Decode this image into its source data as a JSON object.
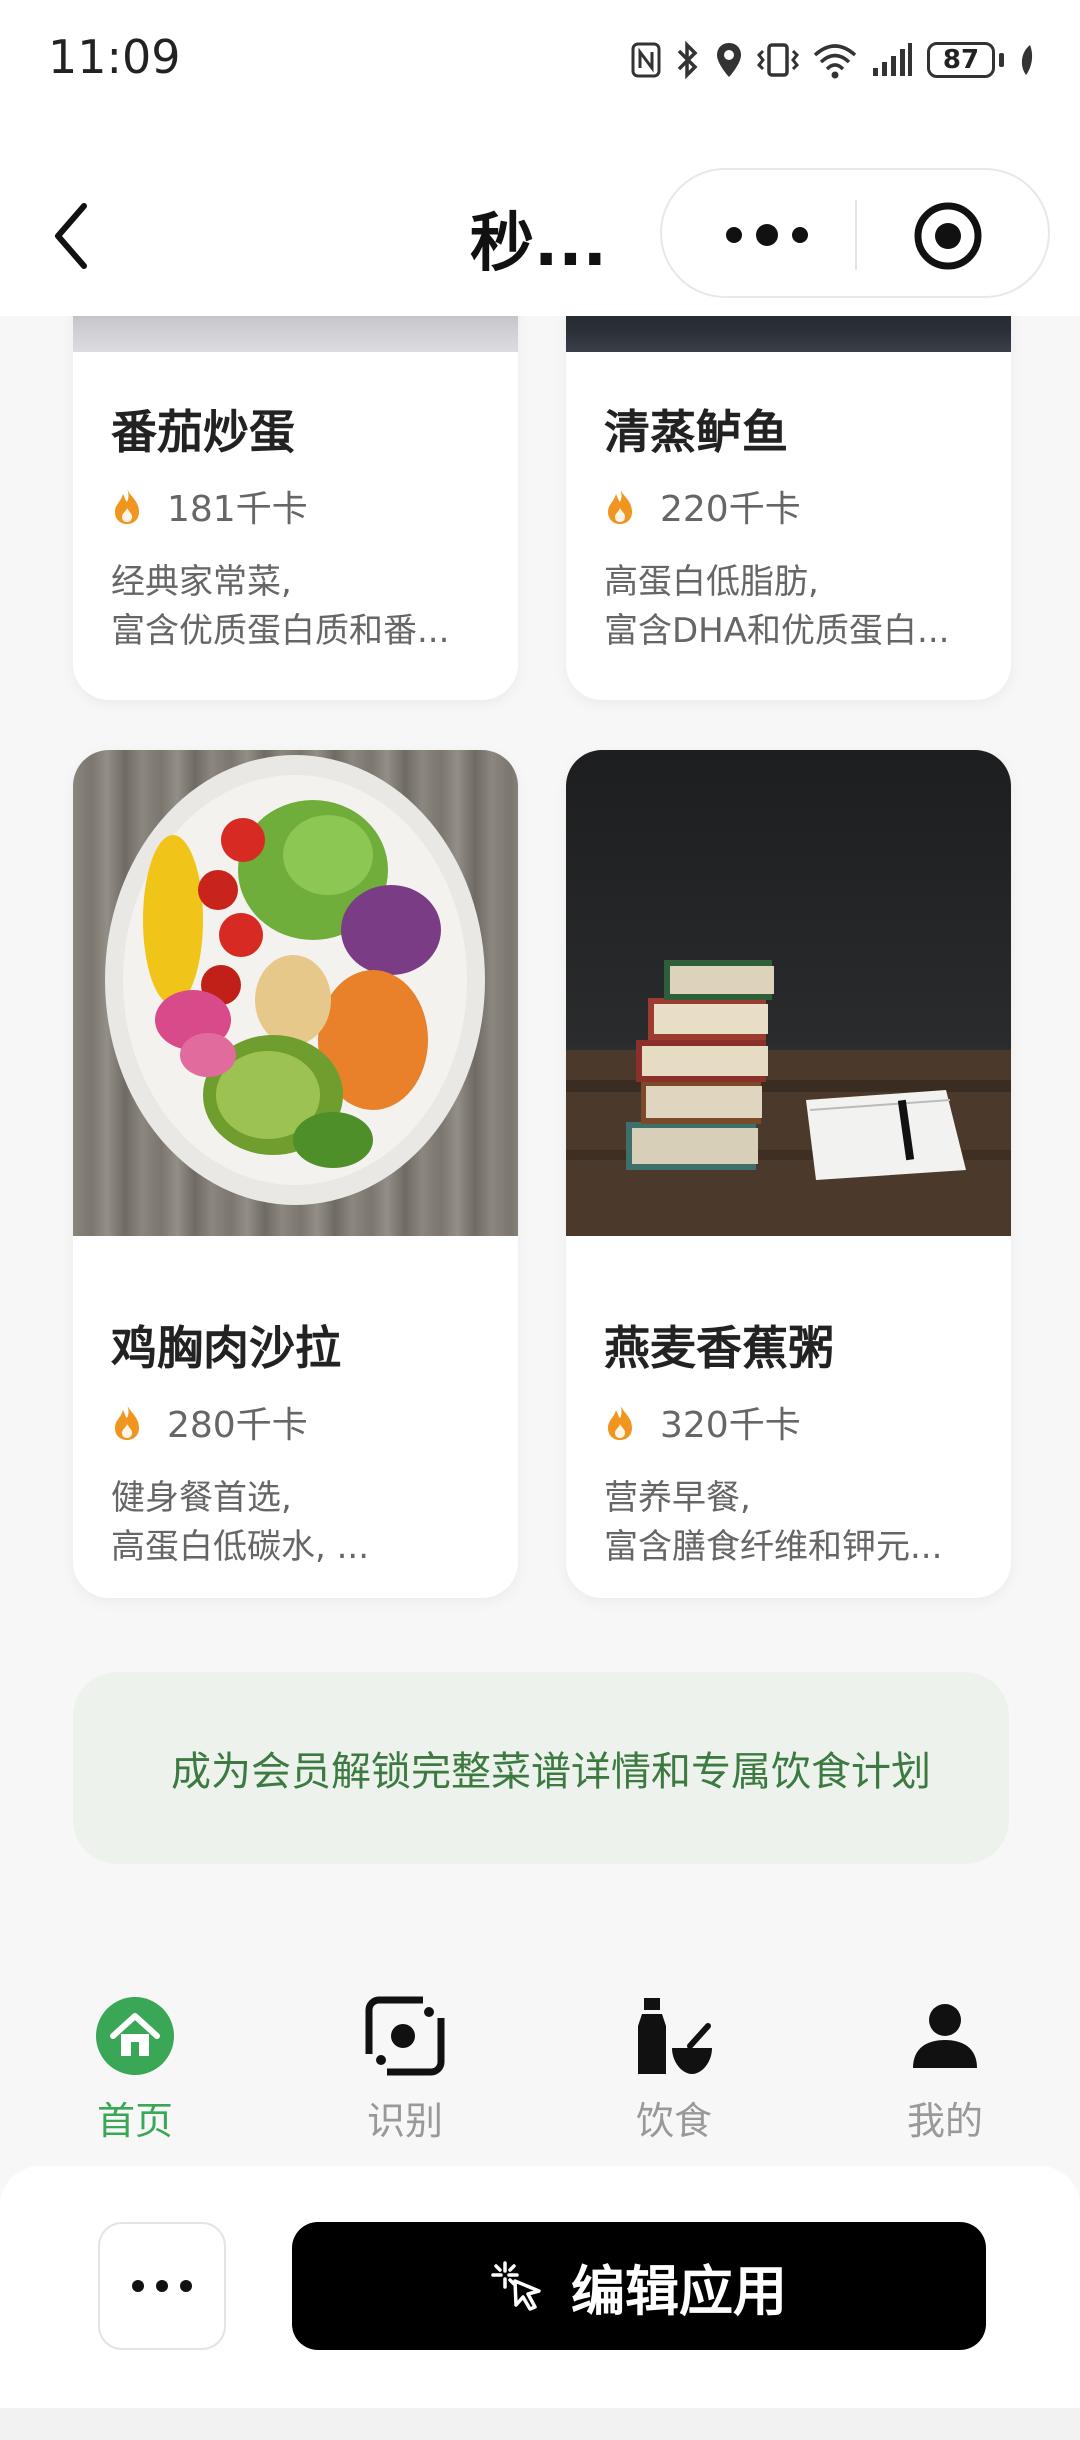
{
  "status_bar": {
    "time": "11:09",
    "battery": "87",
    "icons": [
      "nfc-icon",
      "bluetooth-icon",
      "location-icon",
      "vibrate-icon",
      "wifi-icon",
      "signal-icon",
      "battery-icon",
      "leaf-icon"
    ]
  },
  "nav": {
    "title": "秒...",
    "back_icon": "chevron-left-icon",
    "more_icon": "more-dots-icon",
    "close_icon": "target-close-icon"
  },
  "recipes": [
    {
      "name": "番茄炒蛋",
      "calories": "181千卡",
      "desc_line1": "经典家常菜,",
      "desc_line2": "富含优质蛋白质和番..."
    },
    {
      "name": "清蒸鲈鱼",
      "calories": "220千卡",
      "desc_line1": "高蛋白低脂肪,",
      "desc_line2": "富含DHA和优质蛋白..."
    },
    {
      "name": "鸡胸肉沙拉",
      "calories": "280千卡",
      "desc_line1": "健身餐首选,",
      "desc_line2": "高蛋白低碳水, ..."
    },
    {
      "name": "燕麦香蕉粥",
      "calories": "320千卡",
      "desc_line1": "营养早餐,",
      "desc_line2": "富含膳食纤维和钾元..."
    }
  ],
  "member_banner": {
    "text": "成为会员解锁完整菜谱详情和专属饮食计划"
  },
  "tabs": [
    {
      "label": "首页",
      "icon": "home-icon",
      "active": true
    },
    {
      "label": "识别",
      "icon": "scan-icon",
      "active": false
    },
    {
      "label": "饮食",
      "icon": "bottle-bowl-icon",
      "active": false
    },
    {
      "label": "我的",
      "icon": "person-icon",
      "active": false
    }
  ],
  "bottom_sheet": {
    "more_icon": "more-dots-icon",
    "edit_label": "编辑应用",
    "edit_icon": "sparkle-cursor-icon"
  },
  "colors": {
    "accent_green": "#3aa757",
    "banner_bg": "#edf3ec",
    "banner_text": "#3c7a42",
    "flame": "#f0951f"
  }
}
